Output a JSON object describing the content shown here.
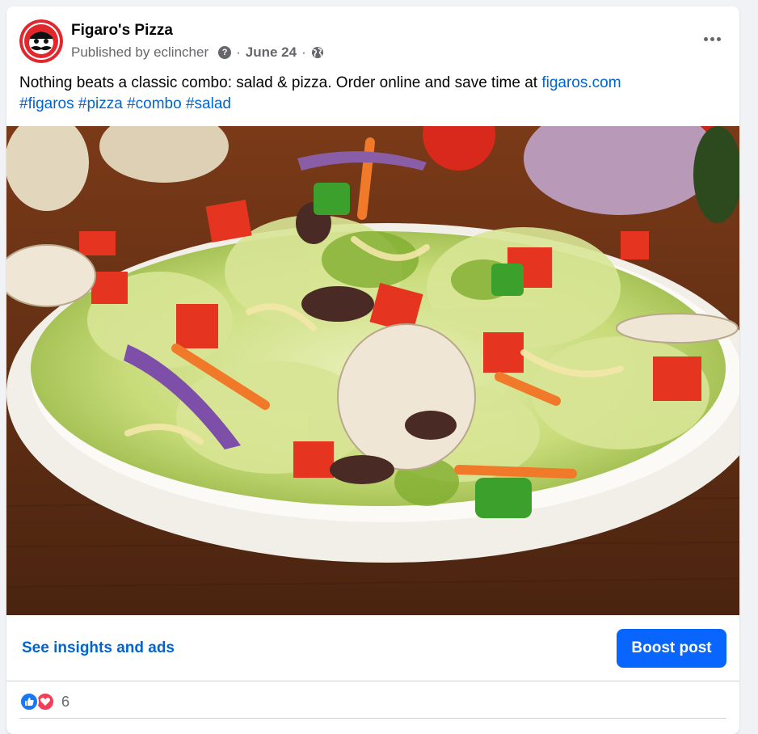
{
  "post": {
    "page_name": "Figaro's Pizza",
    "published_by": "Published by eclincher",
    "date": "June 24",
    "separator": "·",
    "caption_text": "Nothing beats a classic combo: salad & pizza. Order online and save time at ",
    "caption_link": "figaros.com",
    "hashtags": [
      "#figaros",
      "#pizza",
      "#combo",
      "#salad"
    ]
  },
  "actions": {
    "insights_label": "See insights and ads",
    "boost_label": "Boost post"
  },
  "reactions": {
    "count": "6"
  },
  "colors": {
    "link": "#0064d1",
    "boost_button": "#0866ff",
    "like": "#1877f2",
    "love": "#f33e58",
    "logo_red": "#e3262c"
  },
  "icons": [
    "figaros-logo",
    "help-icon",
    "globe-icon",
    "more-icon",
    "like-icon",
    "love-icon"
  ]
}
